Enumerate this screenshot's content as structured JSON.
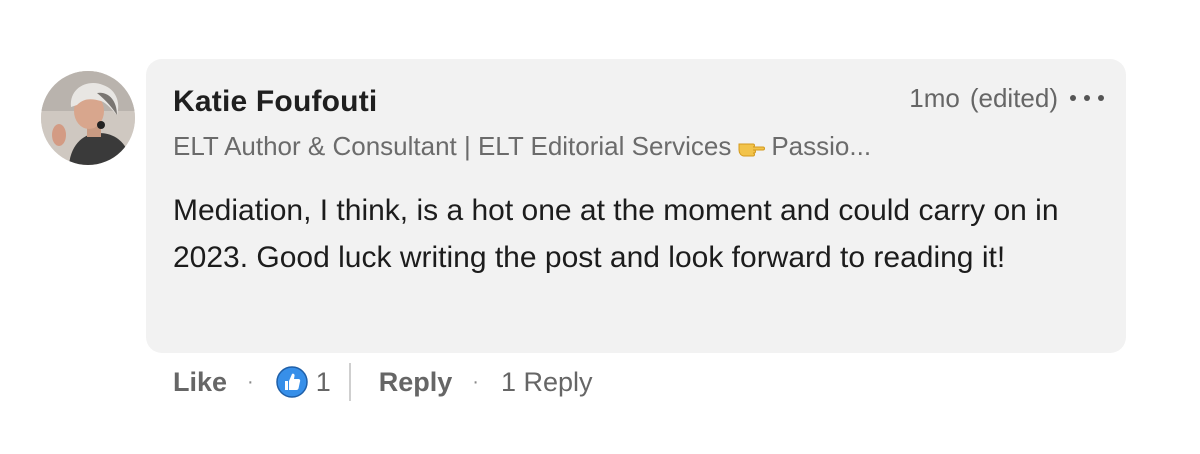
{
  "comment": {
    "author": "Katie Foufouti",
    "headline": "ELT Author & Consultant | ELT Editorial Services",
    "headline_emoji": "pointing-hand-icon",
    "headline_tail": "Passio...",
    "time": "1mo",
    "edited": "(edited)",
    "body": "Mediation, I think, is a hot one at the moment and could carry on in 2023. Good luck writing the post and look forward to reading it!"
  },
  "actions": {
    "like_label": "Like",
    "separator": "·",
    "reaction_count": "1",
    "reply_label": "Reply",
    "replies_label": "1 Reply"
  },
  "colors": {
    "bubble_bg": "#f2f2f2",
    "like_blue": "#378fe9",
    "text_primary": "#1c1c1c",
    "text_secondary": "#666666"
  }
}
